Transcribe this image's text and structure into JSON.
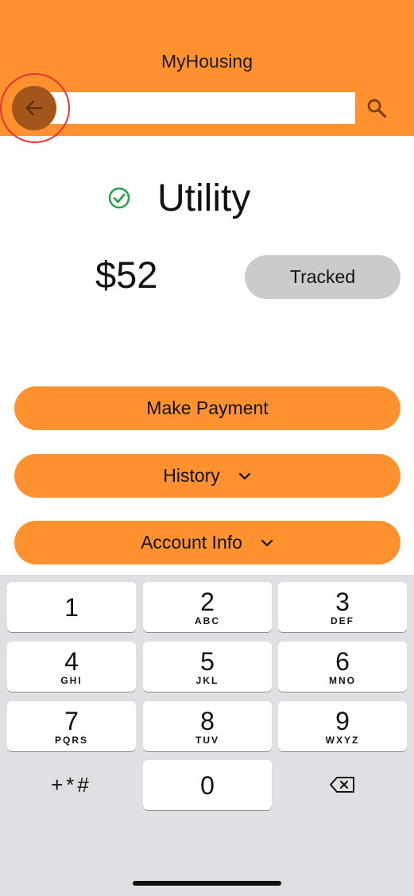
{
  "header": {
    "app_title": "MyHousing",
    "search": {
      "value": "",
      "placeholder": ""
    },
    "back_icon": "arrow-left-icon",
    "search_icon": "magnifier-icon",
    "bg_color": "#FF922F"
  },
  "main": {
    "status_icon": "check-circle-icon",
    "title": "Utility",
    "amount": "$52",
    "tracked_label": "Tracked",
    "buttons": {
      "make_payment": "Make Payment",
      "history": "History",
      "account_info": "Account Info"
    }
  },
  "keypad": {
    "keys": [
      {
        "num": "1",
        "letters": ""
      },
      {
        "num": "2",
        "letters": "ABC"
      },
      {
        "num": "3",
        "letters": "DEF"
      },
      {
        "num": "4",
        "letters": "GHI"
      },
      {
        "num": "5",
        "letters": "JKL"
      },
      {
        "num": "6",
        "letters": "MNO"
      },
      {
        "num": "7",
        "letters": "PQRS"
      },
      {
        "num": "8",
        "letters": "TUV"
      },
      {
        "num": "9",
        "letters": "WXYZ"
      }
    ],
    "symbols": "+*#",
    "zero": "0",
    "backspace_icon": "backspace-icon"
  }
}
